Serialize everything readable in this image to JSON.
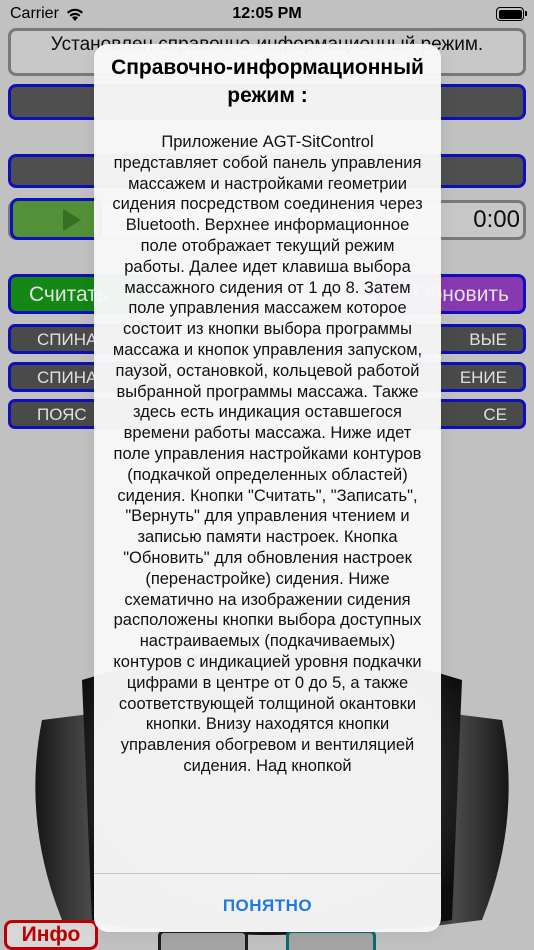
{
  "status": {
    "carrier": "Carrier",
    "time": "12:05 PM"
  },
  "info_banner": "Установлен справочно-информационный режим.",
  "timer": "0:00",
  "buttons": {
    "read": "Считать",
    "update": "Обновить",
    "info": "Инфо"
  },
  "zones_left": [
    "СПИНА",
    "СПИНА",
    "ПОЯС"
  ],
  "zones_right": [
    "ВЫЕ",
    "ЕНИЕ",
    "СЕ"
  ],
  "alert": {
    "title": "Справочно-информационный режим :",
    "message": "Приложение AGT-SitControl представляет собой панель управления массажем и настройками геометрии сидения посредством соединения через Bluetooth. Верхнее информационное поле отображает текущий режим работы. Далее идет клавиша выбора массажного сидения от 1 до 8. Затем поле управления массажем которое состоит из кнопки выбора программы массажа и кнопок управления запуском, паузой, остановкой, кольцевой работой выбранной программы массажа. Также здесь есть индикация оставшегося времени работы массажа. Ниже идет поле управления настройками контуров (подкачкой определенных областей) сидения. Кнопки \"Считать\", \"Записать\", \"Вернуть\" для управления чтением и записью памяти настроек. Кнопка \"Обновить\" для обновления настроек (перенастройке) сидения. Ниже схематично на изображении сидения расположены кнопки выбора доступных настраиваемых (подкачиваемых) контуров с индикацией уровня подкачки цифрами в центре от 0 до 5, а также соответствующей толщиной окантовки кнопки. Внизу находятся кнопки управления обогревом и вентиляцией сидения. Над кнопкой",
    "ok_button": "ПОНЯТНО"
  },
  "colors": {
    "accent_blue": "#1212d6",
    "read_green": "#179a17",
    "update_purple": "#9b41c9",
    "info_red": "#d80000",
    "alert_button": "#1f7ae0"
  }
}
